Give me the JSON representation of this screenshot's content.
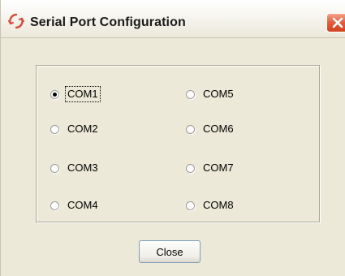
{
  "window": {
    "title": "Serial Port Configuration"
  },
  "ports": [
    {
      "label": "COM1",
      "selected": true
    },
    {
      "label": "COM2",
      "selected": false
    },
    {
      "label": "COM3",
      "selected": false
    },
    {
      "label": "COM4",
      "selected": false
    },
    {
      "label": "COM5",
      "selected": false
    },
    {
      "label": "COM6",
      "selected": false
    },
    {
      "label": "COM7",
      "selected": false
    },
    {
      "label": "COM8",
      "selected": false
    }
  ],
  "buttons": {
    "close_label": "Close"
  },
  "icons": {
    "app": "serial-port-icon",
    "close": "close-icon"
  },
  "colors": {
    "window_bg": "#ece9d8",
    "close_button": "#e5603f"
  }
}
